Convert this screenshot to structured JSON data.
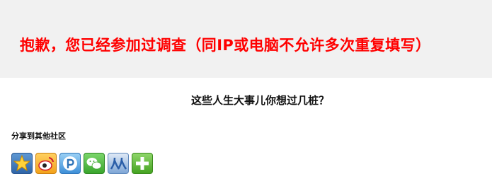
{
  "banner": {
    "message": "抱歉，您已经参加过调查（同IP或电脑不允许多次重复填写）"
  },
  "survey": {
    "title": "这些人生大事儿你想过几桩？"
  },
  "share": {
    "label": "分享到其他社区",
    "icons": [
      {
        "name": "favorite-star-icon"
      },
      {
        "name": "sina-weibo-icon"
      },
      {
        "name": "pinyou-icon"
      },
      {
        "name": "wechat-icon"
      },
      {
        "name": "renren-icon"
      },
      {
        "name": "more-plus-icon"
      }
    ]
  }
}
